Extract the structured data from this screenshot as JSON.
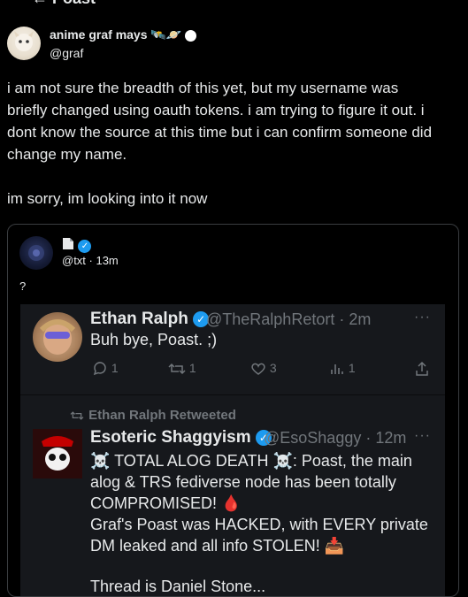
{
  "header": {
    "title": "Poast"
  },
  "post": {
    "author_name": "anime graf mays",
    "author_emoji": "🛰️🪐",
    "author_handle": "@graf",
    "body_lines": [
      "i am not sure the breadth of this yet, but my username was",
      "briefly changed using oauth tokens. i am trying to figure it out. i",
      "dont know the source at this time but i can confirm someone did",
      "change my name."
    ],
    "body_footer": "im sorry, im looking into it now"
  },
  "quote": {
    "handle_meta": "@txt · 13m",
    "text": "?"
  },
  "screenshot": {
    "tweet1": {
      "name": "Ethan Ralph",
      "meta": "@TheRalphRetort · 2m",
      "text": "Buh bye, Poast. ;)",
      "replies": "1",
      "retweets": "1",
      "likes": "3",
      "views": "1"
    },
    "retweet_line": "Ethan Ralph Retweeted",
    "tweet2": {
      "name": "Esoteric Shaggyism",
      "meta": "@EsoShaggy · 12m",
      "lines": [
        "☠️ TOTAL ALOG DEATH ☠️: Poast, the main",
        "alog & TRS fediverse node has been totally",
        "COMPROMISED! 🩸",
        "Graf's Poast was HACKED, with EVERY private",
        "DM leaked and all info STOLEN! 📥"
      ],
      "cut_line": "Thread is Daniel Stone..."
    }
  },
  "colors": {
    "accent": "#1d9bf0",
    "muted": "#71767b",
    "bg": "#000000"
  }
}
